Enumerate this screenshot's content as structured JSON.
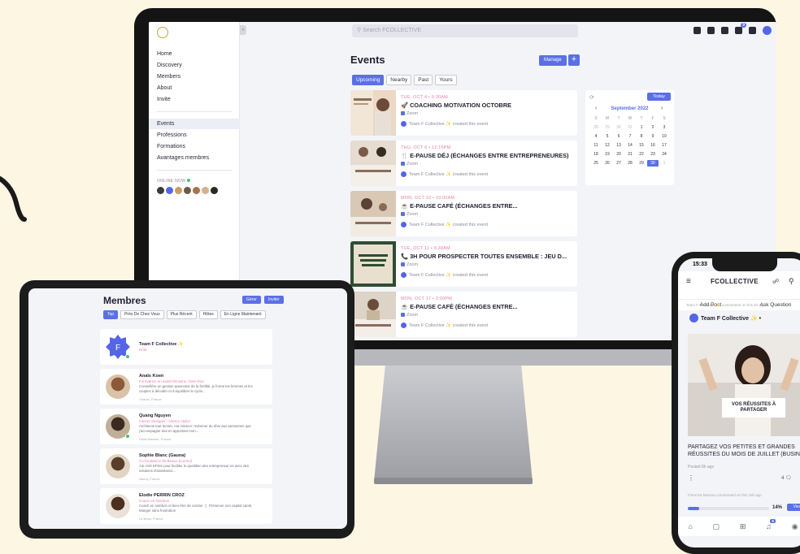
{
  "desktop": {
    "search_placeholder": "Search FCOLLECTIVE",
    "collapse_icon": "‹",
    "notification_count": "9",
    "sidebar": {
      "items": [
        "Home",
        "Discovery",
        "Members",
        "About",
        "Invite"
      ],
      "items2": [
        "Events",
        "Professions",
        "Formations",
        "Avantages membres"
      ],
      "active": "Events",
      "online_label": "ONLINE NOW"
    },
    "events_page": {
      "title": "Events",
      "manage_label": "Manage",
      "add_label": "+",
      "tabs": [
        "Upcoming",
        "Nearby",
        "Past",
        "Yours"
      ],
      "active_tab": "Upcoming",
      "events": [
        {
          "date": "TUE, OCT 4 • 9:30AM",
          "name": "🚀 COACHING MOTIVATION OCTOBRE",
          "location": "Zoom",
          "creator": "Team F Collective ✨ created this event"
        },
        {
          "date": "THU, OCT 6 • 12:15PM",
          "name": "🍴 E-PAUSE DÉJ (ÉCHANGES ENTRE ENTREPRENEURES)",
          "location": "Zoom",
          "creator": "Team F Collective ✨ created this event"
        },
        {
          "date": "MON, OCT 10 • 10:00AM",
          "name": "☕ E-PAUSE CAFÉ (ÉCHANGES ENTRE...",
          "location": "Zoom",
          "creator": "Team F Collective ✨ created this event"
        },
        {
          "date": "TUE, OCT 11 • 9:30AM",
          "name": "📞 3H POUR PROSPECTER TOUTES ENSEMBLE : JEU D...",
          "location": "Zoom",
          "creator": "Team F Collective ✨ created this event"
        },
        {
          "date": "MON, OCT 17 • 2:00PM",
          "name": "☕ E-PAUSE CAFÉ (ÉCHANGES ENTRE...",
          "location": "Zoom",
          "creator": "Team F Collective ✨ created this event"
        }
      ]
    },
    "calendar": {
      "today_label": "Today",
      "month": "September 2022",
      "prev": "‹",
      "next": "›",
      "refresh_icon": "⟳",
      "dow": [
        "S",
        "M",
        "T",
        "W",
        "T",
        "F",
        "S"
      ],
      "days": [
        "28",
        "29",
        "30",
        "31",
        "1",
        "2",
        "3",
        "4",
        "5",
        "6",
        "7",
        "8",
        "9",
        "10",
        "11",
        "12",
        "13",
        "14",
        "15",
        "16",
        "17",
        "18",
        "19",
        "20",
        "21",
        "22",
        "23",
        "24",
        "25",
        "26",
        "27",
        "28",
        "29",
        "30",
        "1"
      ],
      "selected": "30"
    }
  },
  "tablet": {
    "title": "Membres",
    "btn1": "Gérer",
    "btn2": "Inviter",
    "tabs": [
      "Top",
      "Près De Chez Vous",
      "Plus Récent",
      "Hôtes",
      "En Ligne Maintenant"
    ],
    "members": [
      {
        "name": "Team F Collective ✨",
        "role": "Hôte",
        "bio": "",
        "location": ""
      },
      {
        "name": "Anaïs Koen",
        "role": "Formatrice en santé féminine / bien-être",
        "bio": "Conseillère en gestion autonome de la fertilité, je forme les femmes et les couples à décoder et à équilibrer le cycle...",
        "location": "Chaton, France"
      },
      {
        "name": "Quang Nguyen",
        "role": "Interior designer / Interior stylist",
        "bio": "Architecte tout terrain, ma mission: redonner du rêve aux personnes que j'accompagne tout en apportant mon...",
        "location": "Saint-Maxime, France"
      },
      {
        "name": "Sophie Blanc (Gauna)",
        "role": "Co-fondatrice de Beaux Ecureuil",
        "bio": "J'ai créé EPOS pour faciliter le quotidien des entrepreneur·es avec des solutions d'assistance...",
        "location": "Nancy, France"
      },
      {
        "name": "Elodie PERRIN CROZ",
        "role": "Coach en Nutrition",
        "bio": "Coach en nutrition et bien-être de cuisine 🍴 Préserver son capital santé, Manger sans frustration",
        "location": "Le Beau, France"
      }
    ]
  },
  "phone": {
    "time": "15:33",
    "brand": "FCOLLECTIVE",
    "menu_icon": "≡",
    "people_icon": "☍",
    "search_icon": "⚲",
    "add_post": "Add Post",
    "ask_question": "Ask Question",
    "note1": "Team F Collective ✨ commented on this 5h ago",
    "team_name": "Team F Collective ✨ •",
    "image_label": "VOS RÉUSSITES À PARTAGER",
    "post_text": "PARTAGEZ VOS PETITES ET GRANDES RÉUSSITES DU MOIS DE JUILLET (BUSIN",
    "posted": "Posted 8h ago",
    "more_icon": "⋮",
    "comments": "4 🗨",
    "note2": "Florence Moreau commented on this 19h ago",
    "progress_pct": "14%",
    "progress_value": 14,
    "view_label": "View",
    "nav_icons": [
      "⌂",
      "▢",
      "⊞",
      "♫",
      "◉"
    ],
    "nav_badge": "5"
  },
  "colors": {
    "accent": "#5b6fe6",
    "date_pink": "#e880a8",
    "background": "#fdf6e3"
  }
}
